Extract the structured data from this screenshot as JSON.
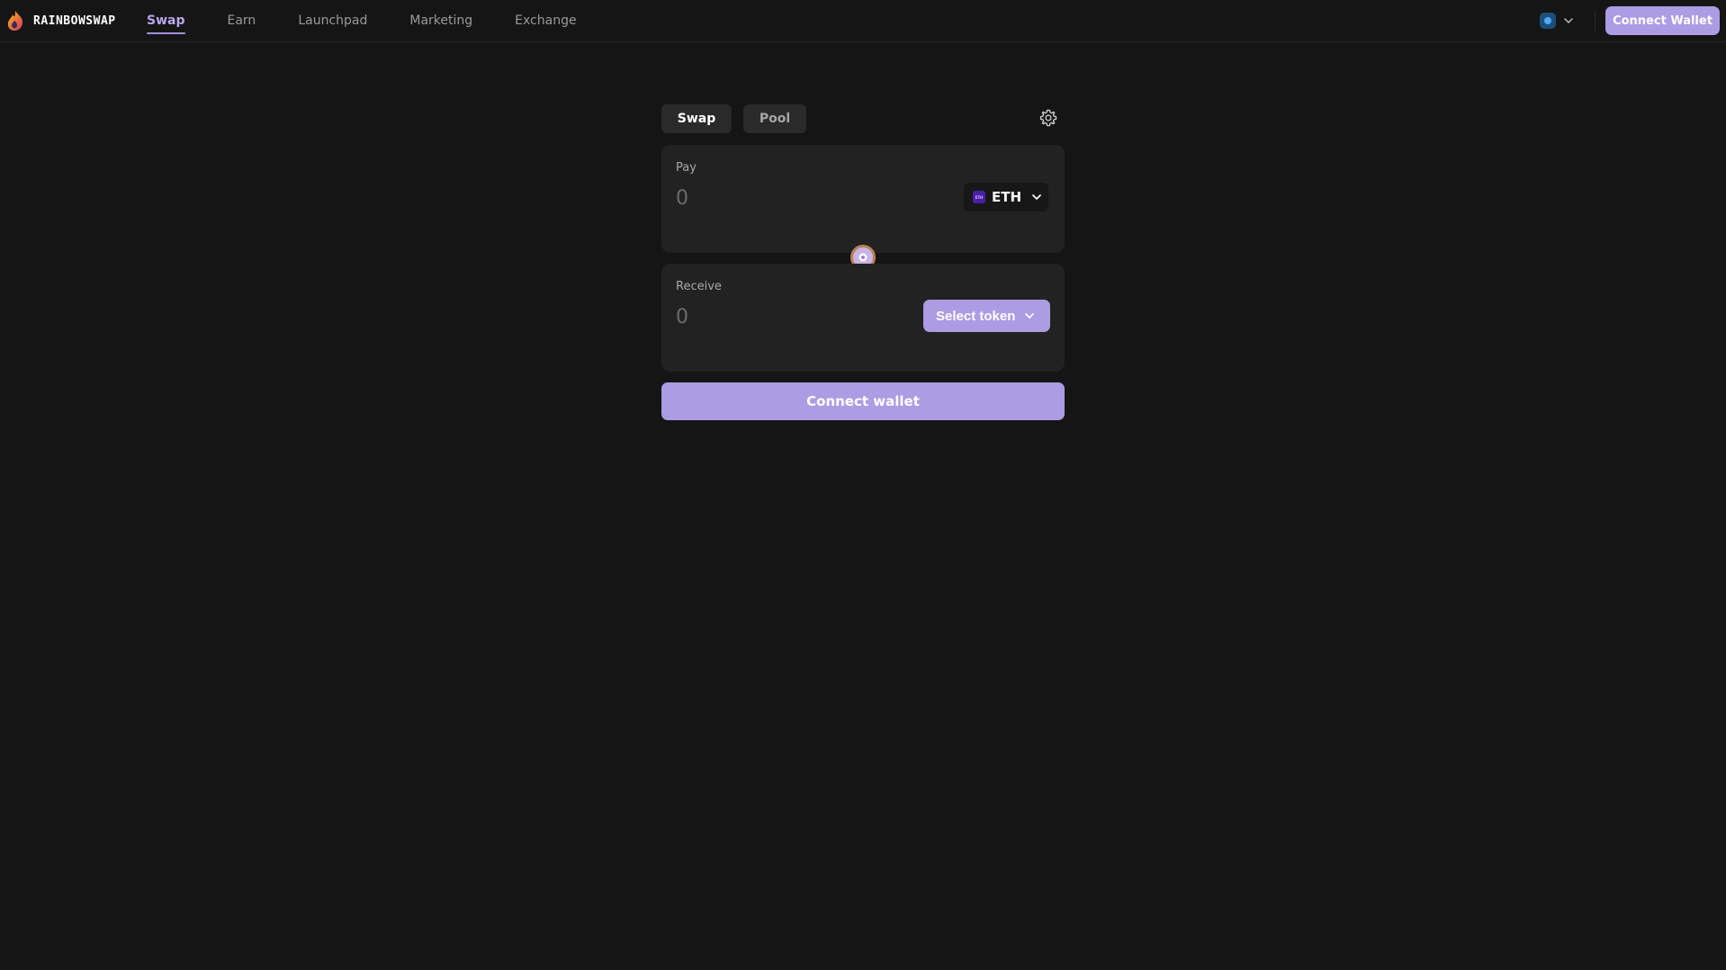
{
  "brand": {
    "name": "RAINBOWSWAP",
    "icon": "rainbow-flame-logo"
  },
  "nav": {
    "items": [
      {
        "label": "Swap",
        "active": true
      },
      {
        "label": "Earn",
        "active": false
      },
      {
        "label": "Launchpad",
        "active": false
      },
      {
        "label": "Marketing",
        "active": false
      },
      {
        "label": "Exchange",
        "active": false
      }
    ]
  },
  "header": {
    "chain_icon": "network-chain-icon",
    "connect_label": "Connect Wallet"
  },
  "swap": {
    "tabs": [
      {
        "label": "Swap",
        "active": true
      },
      {
        "label": "Pool",
        "active": false
      }
    ],
    "settings_icon": "gear-icon",
    "pay": {
      "label": "Pay",
      "placeholder": "0",
      "token": {
        "symbol": "ETH",
        "icon_text": "ETH"
      }
    },
    "toggle_icon": "swap-direction-icon",
    "receive": {
      "label": "Receive",
      "placeholder": "0",
      "select_label": "Select token"
    },
    "connect_label": "Connect wallet"
  },
  "colors": {
    "background": "#151515",
    "panel": "#222222",
    "accent": "#ab9ce3",
    "active_nav": "#b7a7ec"
  }
}
